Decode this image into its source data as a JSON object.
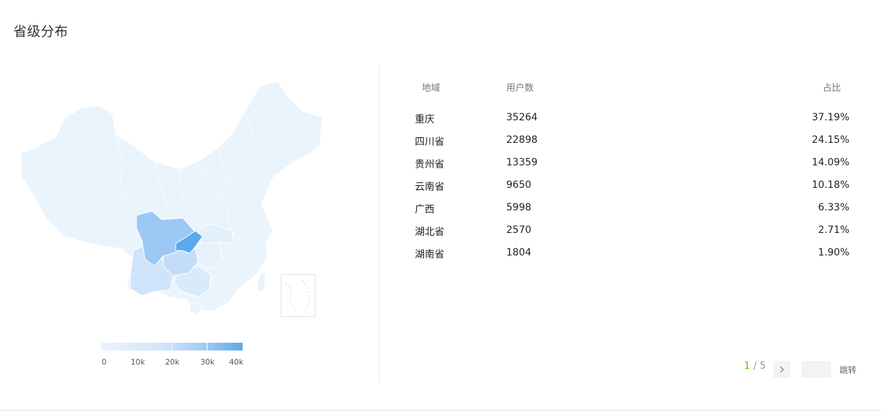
{
  "title": "省级分布",
  "legend": {
    "ticks": [
      "0",
      "10k",
      "20k",
      "30k",
      "40k"
    ]
  },
  "table": {
    "headers": {
      "region": "地域",
      "users": "用户数",
      "share": "占比"
    },
    "rows": [
      {
        "region": "重庆",
        "users": "35264",
        "share": "37.19%"
      },
      {
        "region": "四川省",
        "users": "22898",
        "share": "24.15%"
      },
      {
        "region": "贵州省",
        "users": "13359",
        "share": "14.09%"
      },
      {
        "region": "云南省",
        "users": "9650",
        "share": "10.18%"
      },
      {
        "region": "广西",
        "users": "5998",
        "share": "6.33%"
      },
      {
        "region": "湖北省",
        "users": "2570",
        "share": "2.71%"
      },
      {
        "region": "湖南省",
        "users": "1804",
        "share": "1.90%"
      }
    ]
  },
  "pagination": {
    "current": "1",
    "separator": "/",
    "total": "5",
    "next_icon": "chevron-right-icon",
    "jump_value": "",
    "jump_label": "跳转"
  },
  "colors": {
    "base": "#eaf4fd",
    "chongqing": "#5aa8ee",
    "sichuan": "#9cc9f4",
    "guizhou": "#c3ddf8",
    "yunnan": "#cfe4fa",
    "guangxi": "#d9eafb",
    "hubei": "#e3effc",
    "hunan": "#e6f1fc",
    "page_active": "#52c41a"
  }
}
